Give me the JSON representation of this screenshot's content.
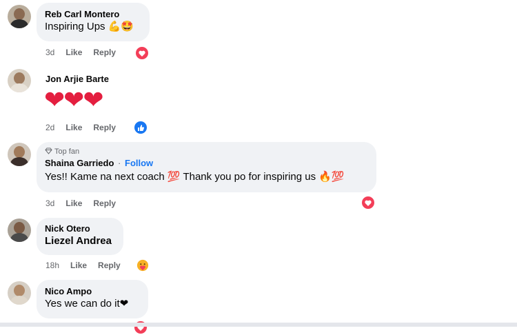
{
  "comments": [
    {
      "author": "Reb Carl Montero",
      "text": "Inspiring Ups 💪🤩",
      "time": "3d",
      "like": "Like",
      "reply": "Reply",
      "reaction_icon": "love-reaction-icon"
    },
    {
      "author": "Jon Arjie Barte",
      "text": "❤❤❤",
      "time": "2d",
      "like": "Like",
      "reply": "Reply",
      "reaction_icon": "like-reaction-icon"
    },
    {
      "badge": "Top fan",
      "author": "Shaina Garriedo",
      "separator": "·",
      "follow": "Follow",
      "text": "Yes!! Kame na next coach 💯 Thank you po for inspiring us 🔥💯",
      "time": "3d",
      "like": "Like",
      "reply": "Reply",
      "reaction_icon": "love-reaction-icon"
    },
    {
      "author": "Nick Otero",
      "text": "Liezel Andrea",
      "time": "18h",
      "like": "Like",
      "reply": "Reply",
      "reaction_icon": "care-reaction-icon"
    },
    {
      "author": "Nico Ampo",
      "text": "Yes we can do it❤",
      "reaction_icon": "love-reaction-icon"
    }
  ],
  "colors": {
    "bubble": "#f0f2f5",
    "love": "#f33e58",
    "like": "#1877f2",
    "follow": "#1877f2",
    "meta": "#65676b"
  }
}
